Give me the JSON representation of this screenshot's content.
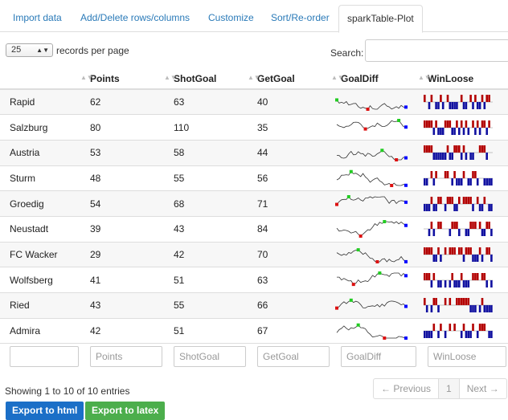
{
  "tabs": [
    "Import data",
    "Add/Delete rows/columns",
    "Customize",
    "Sort/Re-order",
    "sparkTable-Plot"
  ],
  "active_tab": 4,
  "length": {
    "value": "25",
    "label": "records per page"
  },
  "search": {
    "label": "Search:",
    "value": ""
  },
  "columns": [
    "",
    "Points",
    "ShotGoal",
    "GetGoal",
    "GoalDiff",
    "WinLoose"
  ],
  "rows": [
    {
      "team": "Rapid",
      "points": "62",
      "shotgoal": "63",
      "getgoal": "40"
    },
    {
      "team": "Salzburg",
      "points": "80",
      "shotgoal": "110",
      "getgoal": "35"
    },
    {
      "team": "Austria",
      "points": "53",
      "shotgoal": "58",
      "getgoal": "44"
    },
    {
      "team": "Sturm",
      "points": "48",
      "shotgoal": "55",
      "getgoal": "56"
    },
    {
      "team": "Groedig",
      "points": "54",
      "shotgoal": "68",
      "getgoal": "71"
    },
    {
      "team": "Neustadt",
      "points": "39",
      "shotgoal": "43",
      "getgoal": "84"
    },
    {
      "team": "FC Wacker",
      "points": "29",
      "shotgoal": "42",
      "getgoal": "70"
    },
    {
      "team": "Wolfsberg",
      "points": "41",
      "shotgoal": "51",
      "getgoal": "63"
    },
    {
      "team": "Ried",
      "points": "43",
      "shotgoal": "55",
      "getgoal": "66"
    },
    {
      "team": "Admira",
      "points": "42",
      "shotgoal": "51",
      "getgoal": "67"
    }
  ],
  "filters": [
    "",
    "Points",
    "ShotGoal",
    "GetGoal",
    "GoalDiff",
    "WinLoose"
  ],
  "info": "Showing 1 to 10 of 10 entries",
  "pagination": {
    "previous": "← Previous",
    "current": "1",
    "next": "Next →"
  },
  "buttons": {
    "export_html": "Export to html",
    "export_latex": "Export to latex"
  },
  "colors": {
    "link": "#2a7ab8",
    "win": "#b30000",
    "loss": "#1010a0",
    "max_point": "#22cc22",
    "min_point": "#dd1111",
    "last_point": "#0000ff",
    "export_html": "#1b6fc7",
    "export_latex": "#4cae4c"
  }
}
